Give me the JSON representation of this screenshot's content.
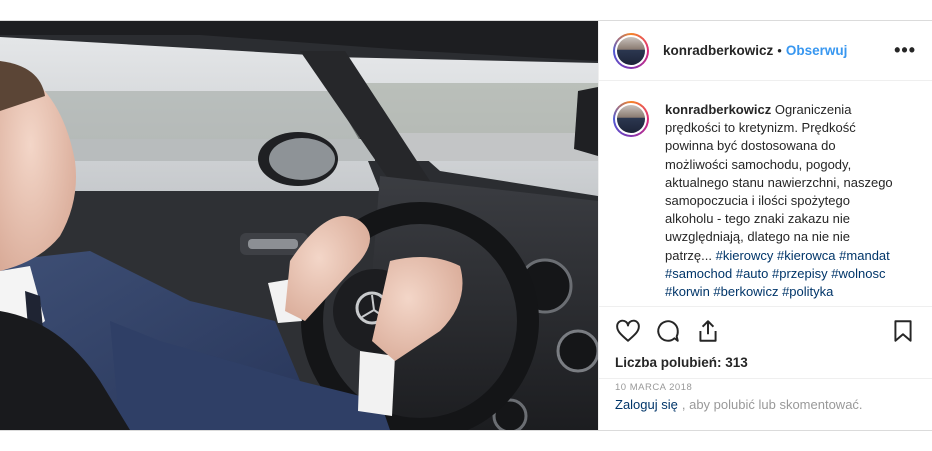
{
  "post": {
    "username": "konradberkowicz",
    "separator": "•",
    "follow_label": "Obserwuj",
    "more_label": "•••",
    "caption_username": "konradberkowicz",
    "caption_text": "Ograniczenia prędkości to kretynizm. Prędkość powinna być dostosowana do możliwości samochodu, pogody, aktualnego stanu nawierzchni, naszego samopoczucia i ilości spożytego alkoholu - tego znaki zakazu nie uwzględniają, dlatego na nie nie patrzę...",
    "hashtags": [
      "#kierowcy",
      "#kierowca",
      "#mandat",
      "#samochod",
      "#auto",
      "#przepisy",
      "#wolnosc",
      "#korwin",
      "#berkowicz",
      "#polityka"
    ],
    "likes_label": "Liczba polubień: 313",
    "date": "10 MARCA 2018",
    "login_link": "Zaloguj się",
    "login_rest": ", aby polubić lub skomentować."
  },
  "icons": {
    "like": "heart-icon",
    "comment": "comment-icon",
    "share": "share-icon",
    "save": "bookmark-icon",
    "more": "more-icon"
  },
  "colors": {
    "link": "#3897f0",
    "hashtag": "#003569",
    "muted": "#999999"
  }
}
